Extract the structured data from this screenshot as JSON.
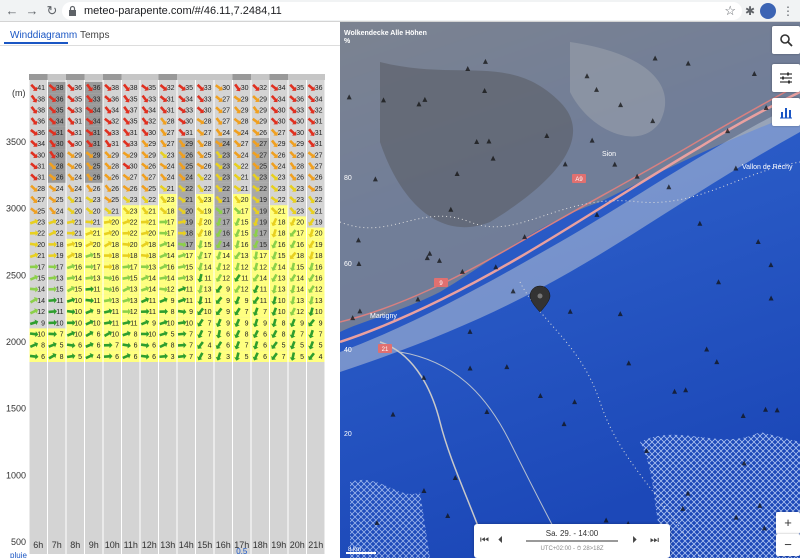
{
  "browser": {
    "url": "meteo-parapente.com/#/46.11,7.2484,11",
    "back_glyph": "←",
    "forward_glyph": "→",
    "reload_glyph": "↻",
    "star_glyph": "☆",
    "puzzle_glyph": "✱",
    "menu_glyph": "⋮"
  },
  "tabs": [
    {
      "label": "Winddiagramm",
      "active": true
    },
    {
      "label": "Temps",
      "active": false
    }
  ],
  "wind": {
    "unit": "(m)",
    "altitude_ticks": [
      {
        "label": "3500",
        "alt": 3500
      },
      {
        "label": "3000",
        "alt": 3000
      },
      {
        "label": "2500",
        "alt": 2500
      },
      {
        "label": "2000",
        "alt": 2000
      },
      {
        "label": "1500",
        "alt": 1500
      },
      {
        "label": "1000",
        "alt": 1000
      },
      {
        "label": "500",
        "alt": 500
      }
    ],
    "rain_label": "pluie",
    "rain_marker": "0.5",
    "hours": [
      "6h",
      "7h",
      "8h",
      "9h",
      "10h",
      "11h",
      "12h",
      "13h",
      "14h",
      "15h",
      "16h",
      "17h",
      "18h",
      "19h",
      "20h",
      "21h"
    ],
    "top_values": [
      "41",
      "38",
      "36",
      "36",
      "38",
      "38",
      "35",
      "32",
      "35",
      "33",
      "30",
      "30",
      "32",
      "34",
      "35",
      "36"
    ],
    "row_count": 25,
    "ground_alt": 1850,
    "colors": {
      "yellow": "#ffff80",
      "green": "#2e9e2e",
      "lightgreen": "#8cd04a",
      "orange": "#f0a020",
      "red": "#e03020",
      "column_gray": "#c8c8c8",
      "cloud_dark": "#888888"
    }
  },
  "map": {
    "title": "Wolkendecke Alle Höhen",
    "title_sub": "%",
    "scale_values": [
      "80",
      "60",
      "40",
      "20"
    ],
    "places": [
      "Sion",
      "Martigny",
      "Vallon de Réchy"
    ],
    "roads": [
      "A9",
      "9",
      "21"
    ],
    "scale_label": "8 km",
    "controls": [
      "search-icon",
      "sliders-icon",
      "chart-icon"
    ],
    "zoom_in": "+",
    "zoom_out": "−"
  },
  "timebar": {
    "date": "Sa. 29. - 14:00",
    "tz": "UTC+02:00 - ⏱ 28>18Z",
    "first_glyph": "⏮",
    "prev_glyph": "⏴",
    "next_glyph": "⏵",
    "last_glyph": "⏭"
  }
}
